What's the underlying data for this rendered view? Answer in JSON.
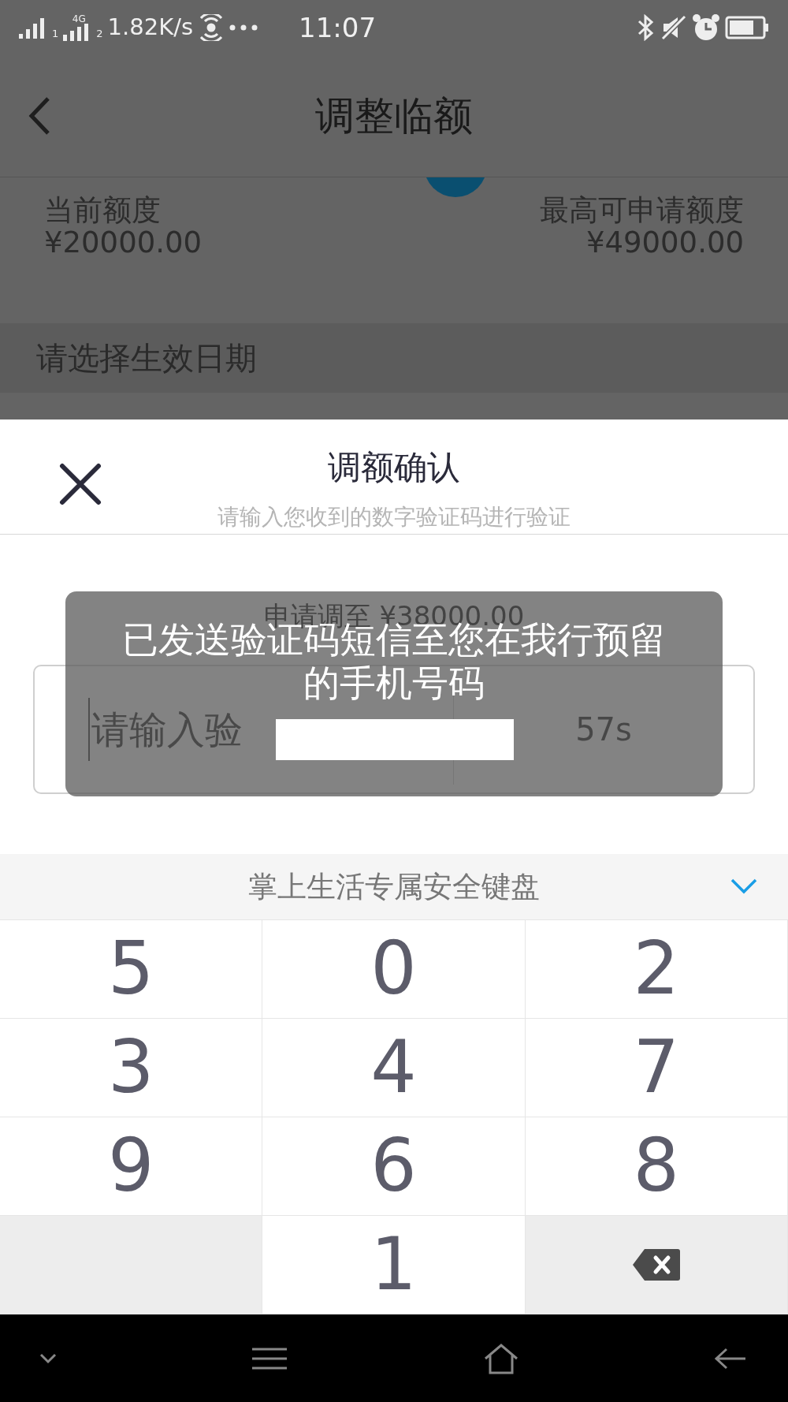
{
  "status_bar": {
    "sim1": "1",
    "network": "4G",
    "sim2": "2",
    "speed": "1.82K/s",
    "time": "11:07"
  },
  "header": {
    "title": "调整临额"
  },
  "limits": {
    "current_label": "当前额度",
    "current_value": "¥20000.00",
    "max_label": "最高可申请额度",
    "max_value": "¥49000.00"
  },
  "date_row": {
    "placeholder": "请选择生效日期"
  },
  "dialog": {
    "title": "调额确认",
    "subtitle": "请输入您收到的数字验证码进行验证",
    "amount": "申请调至 ¥38000.00",
    "code_field": {
      "placeholder": "请输入验"
    },
    "countdown": "57s"
  },
  "toast": {
    "message": "已发送验证码短信至您在我行预留的手机号码"
  },
  "keyboard": {
    "title": "掌上生活专属安全键盘",
    "keys": [
      {
        "kind": "digit",
        "label": "5"
      },
      {
        "kind": "digit",
        "label": "0"
      },
      {
        "kind": "digit",
        "label": "2"
      },
      {
        "kind": "digit",
        "label": "3"
      },
      {
        "kind": "digit",
        "label": "4"
      },
      {
        "kind": "digit",
        "label": "7"
      },
      {
        "kind": "digit",
        "label": "9"
      },
      {
        "kind": "digit",
        "label": "6"
      },
      {
        "kind": "digit",
        "label": "8"
      },
      {
        "kind": "blank"
      },
      {
        "kind": "digit",
        "label": "1"
      },
      {
        "kind": "backspace"
      }
    ]
  }
}
